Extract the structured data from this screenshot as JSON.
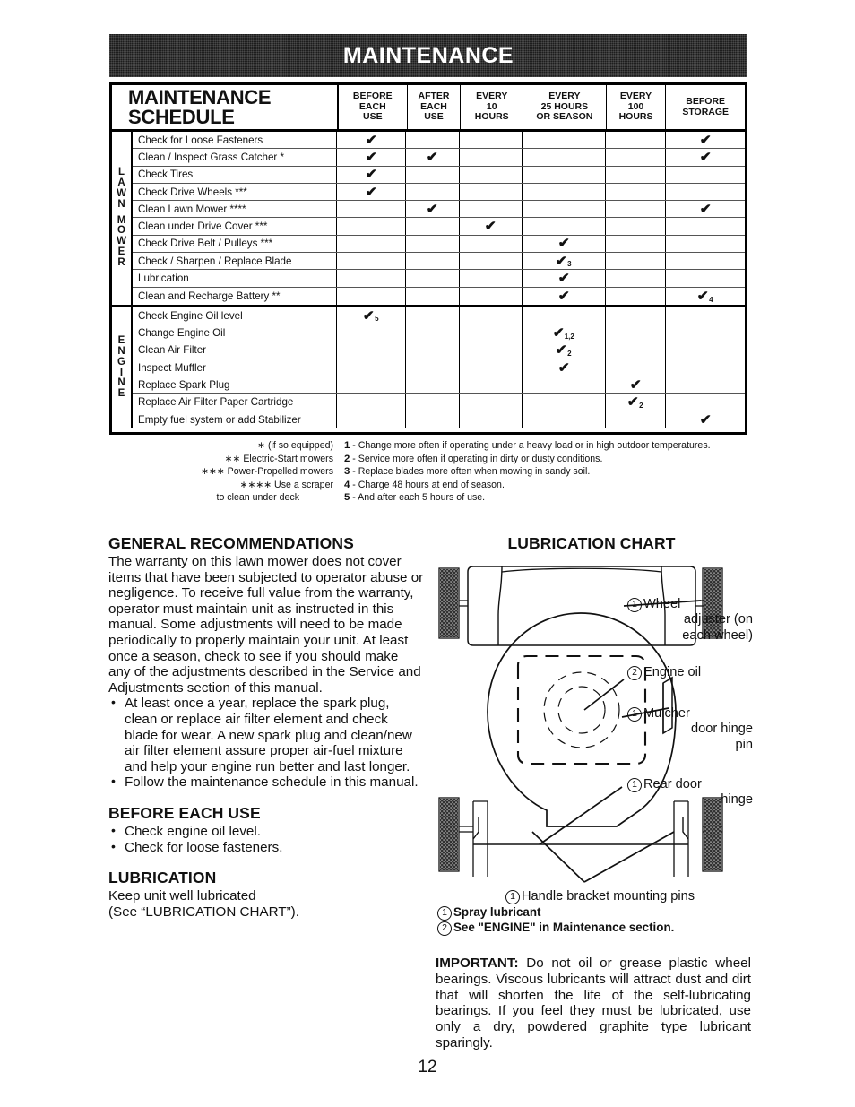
{
  "banner": {
    "title": "MAINTENANCE"
  },
  "page_number": "12",
  "table": {
    "title_line1": "MAINTENANCE",
    "title_line2": "SCHEDULE",
    "columns": [
      "BEFORE\nEACH\nUSE",
      "AFTER\nEACH\nUSE",
      "EVERY\n10\nHOURS",
      "EVERY\n25 HOURS\nOR SEASON",
      "EVERY\n100\nHOURS",
      "BEFORE\nSTORAGE"
    ],
    "groups": [
      {
        "label": "LAWN MOWER",
        "label_letters": [
          "L",
          "A",
          "W",
          "N",
          "",
          "M",
          "O",
          "W",
          "E",
          "R"
        ],
        "rows": [
          {
            "task": "Check for Loose Fasteners",
            "marks": [
              "✔",
              "",
              "",
              "",
              "",
              "✔"
            ],
            "subs": [
              "",
              "",
              "",
              "",
              "",
              ""
            ]
          },
          {
            "task": "Clean / Inspect Grass Catcher *",
            "marks": [
              "✔",
              "✔",
              "",
              "",
              "",
              "✔"
            ],
            "subs": [
              "",
              "",
              "",
              "",
              "",
              ""
            ]
          },
          {
            "task": "Check Tires",
            "marks": [
              "✔",
              "",
              "",
              "",
              "",
              ""
            ],
            "subs": [
              "",
              "",
              "",
              "",
              "",
              ""
            ]
          },
          {
            "task": "Check Drive Wheels ***",
            "marks": [
              "✔",
              "",
              "",
              "",
              "",
              ""
            ],
            "subs": [
              "",
              "",
              "",
              "",
              "",
              ""
            ]
          },
          {
            "task": "Clean Lawn Mower ****",
            "marks": [
              "",
              "✔",
              "",
              "",
              "",
              "✔"
            ],
            "subs": [
              "",
              "",
              "",
              "",
              "",
              ""
            ]
          },
          {
            "task": "Clean under Drive Cover ***",
            "marks": [
              "",
              "",
              "✔",
              "",
              "",
              ""
            ],
            "subs": [
              "",
              "",
              "",
              "",
              "",
              ""
            ]
          },
          {
            "task": "Check Drive Belt / Pulleys ***",
            "marks": [
              "",
              "",
              "",
              "✔",
              "",
              ""
            ],
            "subs": [
              "",
              "",
              "",
              "",
              "",
              ""
            ]
          },
          {
            "task": "Check / Sharpen / Replace Blade",
            "marks": [
              "",
              "",
              "",
              "✔",
              "",
              ""
            ],
            "subs": [
              "",
              "",
              "",
              "3",
              "",
              ""
            ]
          },
          {
            "task": "Lubrication",
            "marks": [
              "",
              "",
              "",
              "✔",
              "",
              ""
            ],
            "subs": [
              "",
              "",
              "",
              "",
              "",
              ""
            ]
          },
          {
            "task": "Clean and Recharge Battery **",
            "marks": [
              "",
              "",
              "",
              "✔",
              "",
              "✔"
            ],
            "subs": [
              "",
              "",
              "",
              "",
              "",
              "4"
            ]
          }
        ]
      },
      {
        "label": "ENGINE",
        "label_letters": [
          "E",
          "N",
          "G",
          "I",
          "N",
          "E"
        ],
        "rows": [
          {
            "task": "Check Engine Oil level",
            "marks": [
              "✔",
              "",
              "",
              "",
              "",
              ""
            ],
            "subs": [
              "5",
              "",
              "",
              "",
              "",
              ""
            ]
          },
          {
            "task": "Change Engine Oil",
            "marks": [
              "",
              "",
              "",
              "✔",
              "",
              ""
            ],
            "subs": [
              "",
              "",
              "",
              "1,2",
              "",
              ""
            ]
          },
          {
            "task": "Clean Air Filter",
            "marks": [
              "",
              "",
              "",
              "✔",
              "",
              ""
            ],
            "subs": [
              "",
              "",
              "",
              "2",
              "",
              ""
            ]
          },
          {
            "task": "Inspect Muffler",
            "marks": [
              "",
              "",
              "",
              "✔",
              "",
              ""
            ],
            "subs": [
              "",
              "",
              "",
              "",
              "",
              ""
            ]
          },
          {
            "task": "Replace Spark Plug",
            "marks": [
              "",
              "",
              "",
              "",
              "✔",
              ""
            ],
            "subs": [
              "",
              "",
              "",
              "",
              "",
              ""
            ]
          },
          {
            "task": "Replace Air Filter Paper Cartridge",
            "marks": [
              "",
              "",
              "",
              "",
              "✔",
              ""
            ],
            "subs": [
              "",
              "",
              "",
              "",
              "2",
              ""
            ]
          },
          {
            "task": "Empty fuel system or add Stabilizer",
            "marks": [
              "",
              "",
              "",
              "",
              "",
              "✔"
            ],
            "subs": [
              "",
              "",
              "",
              "",
              "",
              ""
            ]
          }
        ]
      }
    ]
  },
  "footnotes": {
    "symbols": [
      "∗ (if so equipped)",
      "∗∗ Electric-Start mowers",
      "∗∗∗ Power-Propelled mowers",
      "∗∗∗∗ Use a scraper",
      "to clean under deck"
    ],
    "numbered": [
      {
        "num": "1",
        "text": "- Change more often if operating under a heavy load or in high outdoor temperatures."
      },
      {
        "num": "2",
        "text": "- Service more often if operating in dirty or dusty conditions."
      },
      {
        "num": "3",
        "text": "- Replace blades more often when mowing in sandy soil."
      },
      {
        "num": "4",
        "text": "- Charge 48 hours at end of season."
      },
      {
        "num": "5",
        "text": "- And after each 5 hours of use."
      }
    ]
  },
  "left_column": {
    "general_heading": "GENERAL RECOMMENDATIONS",
    "general_body": "The warranty on this lawn mower does not cover items that have been subjected to operator abuse or negligence.  To receive full value from the warranty, operator must maintain unit as instructed in this manual. Some adjustments will need to be made periodically to properly maintain your unit. At least once a season, check to see if you should make any of the adjustments described in the Service and Adjustments section of this manual.",
    "general_bullets": [
      "At least once a year, replace the spark plug, clean or replace air filter element and check blade for wear.  A new spark plug and clean/new air filter element assure proper air-fuel mixture and help your engine run better and last longer.",
      "Follow the maintenance schedule in this manual."
    ],
    "before_use_heading": "BEFORE EACH USE",
    "before_use_bullets": [
      "Check engine oil level.",
      "Check for loose fasteners."
    ],
    "lubrication_heading": "LUBRICATION",
    "lubrication_body_line1": "Keep unit well lubricated",
    "lubrication_body_line2": "(See “LUBRICATION CHART”)."
  },
  "right_column": {
    "chart_heading": "LUBRICATION CHART",
    "callouts": [
      {
        "num": "1",
        "text": "Wheel",
        "line2": "adjuster (on",
        "line3": "each wheel)"
      },
      {
        "num": "2",
        "text": "Engine oil",
        "line2": "",
        "line3": ""
      },
      {
        "num": "1",
        "text": "Mulcher",
        "line2": "door hinge",
        "line3": "pin"
      },
      {
        "num": "1",
        "text": "Rear door",
        "line2": "hinge",
        "line3": ""
      },
      {
        "num": "1",
        "text": "Handle bracket mounting pins",
        "line2": "",
        "line3": ""
      }
    ],
    "key": [
      {
        "num": "1",
        "text": "Spray lubricant"
      },
      {
        "num": "2",
        "text": "See \"ENGINE\" in Maintenance section."
      }
    ],
    "important_label": "IMPORTANT:",
    "important_text": "  Do not oil or grease plastic wheel bearings.  Viscous lubricants will attract dust and dirt that will shorten the life of the self-lubricating bearings.  If you feel they must be lubricated, use only a dry, powdered graphite type lubricant sparingly."
  }
}
